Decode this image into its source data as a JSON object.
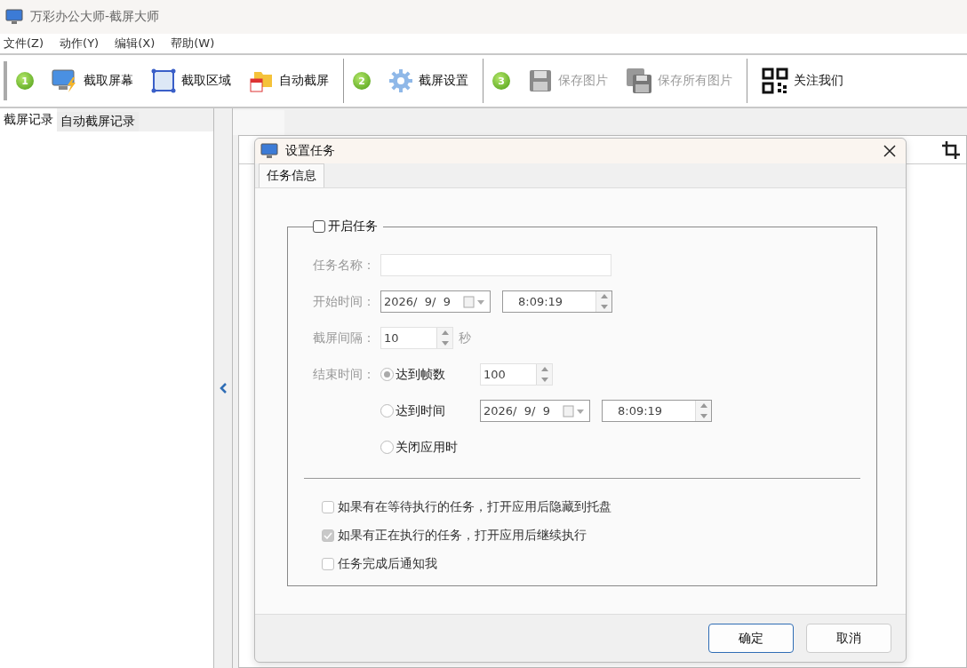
{
  "window": {
    "title": "万彩办公大师-截屏大师"
  },
  "menu": [
    "文件(Z)",
    "动作(Y)",
    "编辑(X)",
    "帮助(W)"
  ],
  "toolbar": [
    {
      "kind": "step",
      "label": "1"
    },
    {
      "kind": "button",
      "label": "截取屏幕",
      "disabled": false
    },
    {
      "kind": "button",
      "label": "截取区域",
      "disabled": false
    },
    {
      "kind": "button",
      "label": "自动截屏",
      "disabled": false
    },
    {
      "kind": "separator"
    },
    {
      "kind": "step",
      "label": "2"
    },
    {
      "kind": "button",
      "label": "截屏设置",
      "disabled": false
    },
    {
      "kind": "separator"
    },
    {
      "kind": "step",
      "label": "3"
    },
    {
      "kind": "button",
      "label": "保存图片",
      "disabled": true
    },
    {
      "kind": "button",
      "label": "保存所有图片",
      "disabled": true
    },
    {
      "kind": "separator"
    },
    {
      "kind": "button",
      "label": "关注我们",
      "disabled": false
    }
  ],
  "left_panel": {
    "tabs": [
      {
        "label": "截屏记录",
        "selected": true
      },
      {
        "label": "自动截屏记录",
        "selected": false
      }
    ]
  },
  "dialog": {
    "title": "设置任务",
    "tabs": [
      {
        "label": "任务信息",
        "selected": true
      }
    ],
    "task": {
      "label": "开启任务",
      "checked": false
    },
    "name": {
      "label": "任务名称："
    },
    "start": {
      "label": "开始时间：",
      "date": "2026/  9/  9",
      "time": "8:09:19"
    },
    "interval": {
      "label": "截屏间隔：",
      "value": "10",
      "unit": "秒"
    },
    "end": {
      "label": "结束时间：",
      "options": [
        {
          "kind": "frames",
          "label": "达到帧数",
          "selected": true,
          "value": "100"
        },
        {
          "kind": "time",
          "label": "达到时间",
          "selected": false,
          "date": "2026/  9/  9",
          "time": "8:09:19"
        },
        {
          "kind": "plain",
          "label": "关闭应用时",
          "selected": false
        }
      ]
    },
    "options": [
      {
        "label": "如果有在等待执行的任务，打开应用后隐藏到托盘",
        "checked": false
      },
      {
        "label": "如果有正在执行的任务，打开应用后继续执行",
        "checked": true
      },
      {
        "label": "任务完成后通知我",
        "checked": false
      }
    ],
    "buttons": [
      {
        "label": "确定",
        "default": true
      },
      {
        "label": "取消",
        "default": false
      }
    ]
  }
}
